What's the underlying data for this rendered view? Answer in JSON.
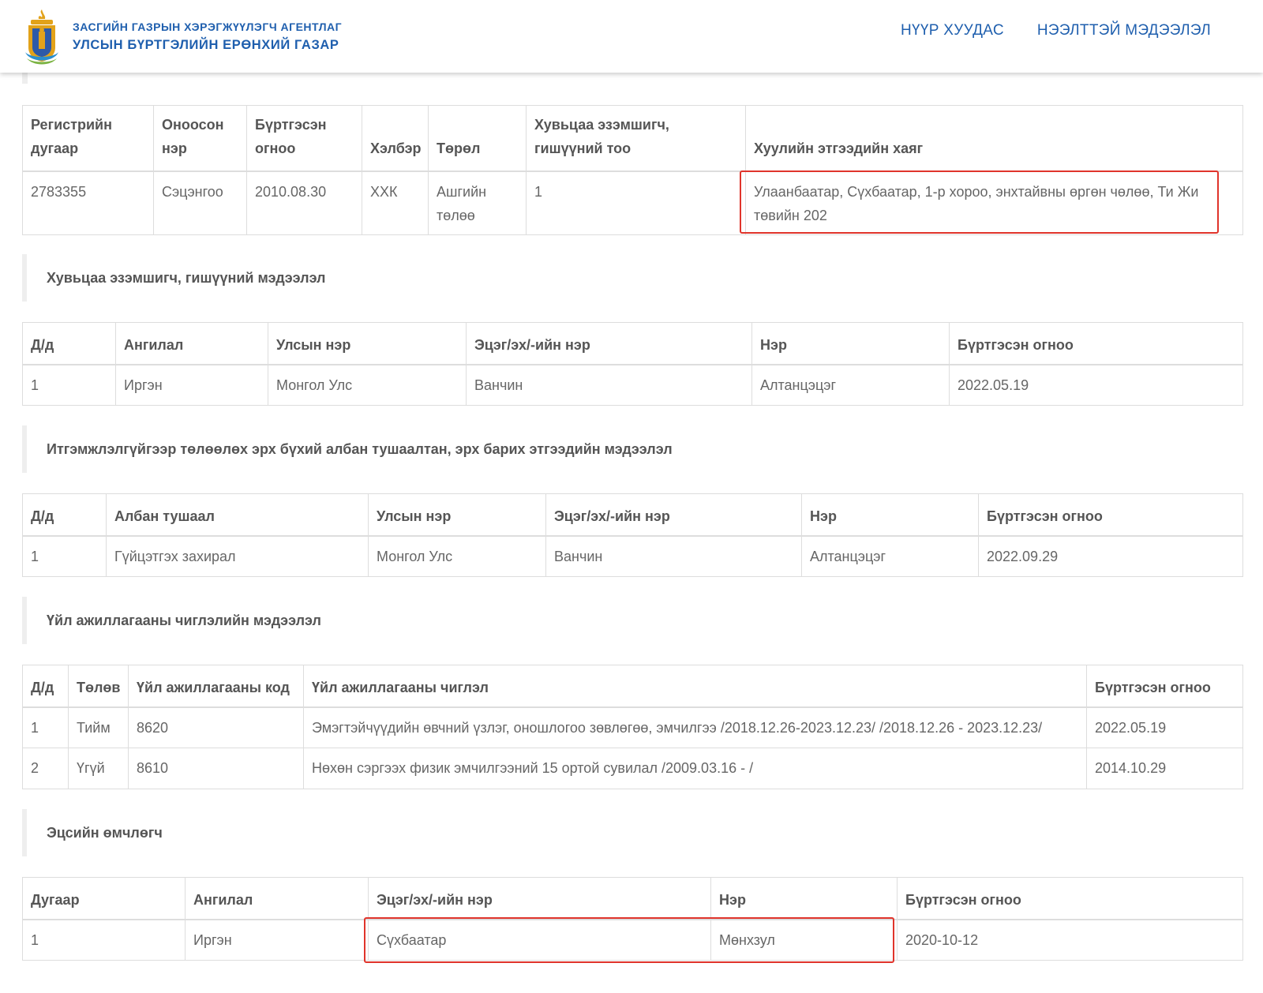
{
  "header": {
    "org_line1": "ЗАСГИЙН ГАЗРЫН ХЭРЭГЖҮҮЛЭГЧ АГЕНТЛАГ",
    "org_line2": "УЛСЫН БҮРТГЭЛИЙН ЕРӨНХИЙ ГАЗАР",
    "logo_icon": "soyombo-emblem-icon",
    "nav": [
      "НҮҮР ХУУДАС",
      "НЭЭЛТТЭЙ МЭДЭЭЛЭЛ"
    ]
  },
  "colors": {
    "brand": "#1f5fae",
    "highlight": "#e0342b",
    "border": "#dddddd"
  },
  "company": {
    "columns": [
      "Регистрийн дугаар",
      "Оноосон нэр",
      "Бүртгэсэн огноо",
      "Хэлбэр",
      "Төрөл",
      "Хувьцаа эзэмшигч, гишүүний тоо",
      "Хуулийн этгээдийн хаяг"
    ],
    "row": [
      "2783355",
      "Сэцэнгоо",
      "2010.08.30",
      "ХХК",
      "Ашгийн төлөө",
      "1",
      "Улаанбаатар, Сүхбаатар, 1-р хороо, энхтайвны өргөн чөлөө, Ти Жи төвийн 202"
    ]
  },
  "shareholders": {
    "title": "Хувьцаа эзэмшигч, гишүүний мэдээлэл",
    "columns": [
      "Д/д",
      "Ангилал",
      "Улсын нэр",
      "Эцэг/эх/-ийн нэр",
      "Нэр",
      "Бүртгэсэн огноо"
    ],
    "rows": [
      [
        "1",
        "Иргэн",
        "Монгол Улс",
        "Ванчин",
        "Алтанцэцэг",
        "2022.05.19"
      ]
    ]
  },
  "officials": {
    "title": "Итгэмжлэлгүйгээр төлөөлөх эрх бүхий албан тушаалтан, эрх барих этгээдийн мэдээлэл",
    "columns": [
      "Д/д",
      "Албан тушаал",
      "Улсын нэр",
      "Эцэг/эх/-ийн нэр",
      "Нэр",
      "Бүртгэсэн огноо"
    ],
    "rows": [
      [
        "1",
        "Гүйцэтгэх захирал",
        "Монгол Улс",
        "Ванчин",
        "Алтанцэцэг",
        "2022.09.29"
      ]
    ]
  },
  "activities": {
    "title": "Үйл ажиллагааны чиглэлийн мэдээлэл",
    "columns": [
      "Д/д",
      "Төлөв",
      "Үйл ажиллагааны код",
      "Үйл ажиллагааны чиглэл",
      "Бүртгэсэн огноо"
    ],
    "rows": [
      [
        "1",
        "Тийм",
        "8620",
        "Эмэгтэйчүүдийн өвчний үзлэг, оношлогоо зөвлөгөө, эмчилгээ /2018.12.26-2023.12.23/ /2018.12.26 - 2023.12.23/",
        "2022.05.19"
      ],
      [
        "2",
        "Үгүй",
        "8610",
        "Нөхөн сэргээх физик эмчилгээний 15 ортой сувилал /2009.03.16 - /",
        "2014.10.29"
      ]
    ]
  },
  "beneficiaries": {
    "title": "Эцсийн өмчлөгч",
    "columns": [
      "Дугаар",
      "Ангилал",
      "Эцэг/эх/-ийн нэр",
      "Нэр",
      "Бүртгэсэн огноо"
    ],
    "rows": [
      [
        "1",
        "Иргэн",
        "Сүхбаатар",
        "Мөнхзул",
        "2020-10-12"
      ]
    ]
  }
}
